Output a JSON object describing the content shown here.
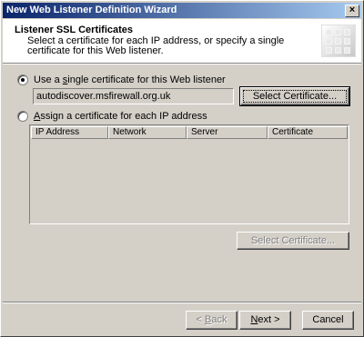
{
  "window": {
    "title": "New Web Listener Definition Wizard",
    "close_label": "×"
  },
  "header": {
    "title": "Listener SSL Certificates",
    "subtitle": "Select a certificate for each IP address, or specify a single certificate for this Web listener."
  },
  "options": {
    "single_prefix": "Use a ",
    "single_mnemonic": "s",
    "single_rest": "ingle certificate for this Web listener",
    "single_selected": true,
    "certificate_value": "autodiscover.msfirewall.org.uk",
    "select_certificate_label": "Select Certificate...",
    "assign_mnemonic": "A",
    "assign_rest": "ssign a certificate for each IP address",
    "assign_selected": false
  },
  "table": {
    "columns": [
      "IP Address",
      "Network",
      "Server",
      "Certificate"
    ],
    "rows": [],
    "select_certificate_label": "Select Certificate..."
  },
  "footer": {
    "back_mnemonic": "B",
    "back_prefix": "< ",
    "back_rest": "ack",
    "next_mnemonic": "N",
    "next_rest": "ext >",
    "cancel_label": "Cancel"
  }
}
